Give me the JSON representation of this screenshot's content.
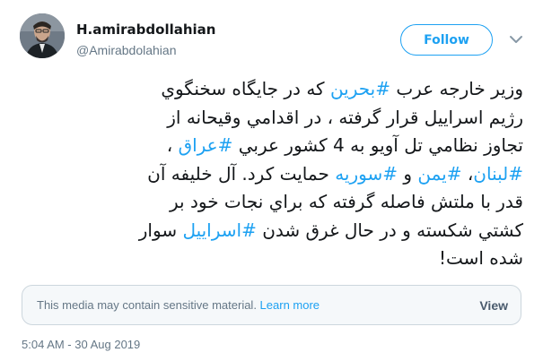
{
  "user": {
    "display_name": "H.amirabdollahian",
    "handle": "@Amirabdolahian",
    "avatar_icon": "profile-photo"
  },
  "follow": {
    "label": "Follow"
  },
  "menu": {
    "icon": "chevron-down-icon"
  },
  "tweet": {
    "lines": [
      [
        {
          "t": "وزیر خارجه عرب ",
          "h": false
        },
        {
          "t": "#بحرين",
          "h": true
        },
        {
          "t": "  که در جایگاه سخنگوي",
          "h": false
        }
      ],
      [
        {
          "t": "رژیم اسراییل قرار گرفته ، در اقدامي وقیحانه از",
          "h": false
        }
      ],
      [
        {
          "t": "تجاوز نظامي تل آویو به 4 کشور عربي ",
          "h": true,
          "skip": true
        },
        {
          "t": "#عراق",
          "h": true
        },
        {
          "t": " ،",
          "h": false
        }
      ],
      [
        {
          "t": "#لبنان",
          "h": true
        },
        {
          "t": "، ",
          "h": false
        },
        {
          "t": "#یمن",
          "h": true
        },
        {
          "t": " و ",
          "h": false
        },
        {
          "t": "#سوریه",
          "h": true
        },
        {
          "t": " حمایت  کرد. آل خلیفه آن",
          "h": false
        }
      ],
      [
        {
          "t": "قدر با ملتش فاصله گرفته که براي نجات خود بر",
          "h": false
        }
      ],
      [
        {
          "t": "کشتي شکسته و در حال غرق شدن ",
          "h": false
        },
        {
          "t": "#اسراییل",
          "h": true
        },
        {
          "t": " سوار",
          "h": false
        }
      ],
      [
        {
          "t": "شده است!",
          "h": false
        }
      ]
    ]
  },
  "sensitive": {
    "message": "This media may contain sensitive material. ",
    "learn_more": "Learn more",
    "view": "View"
  },
  "timestamp": "5:04 AM - 30 Aug 2019",
  "colors": {
    "accent": "#1da1f2",
    "muted": "#657786",
    "text": "#14171a"
  }
}
